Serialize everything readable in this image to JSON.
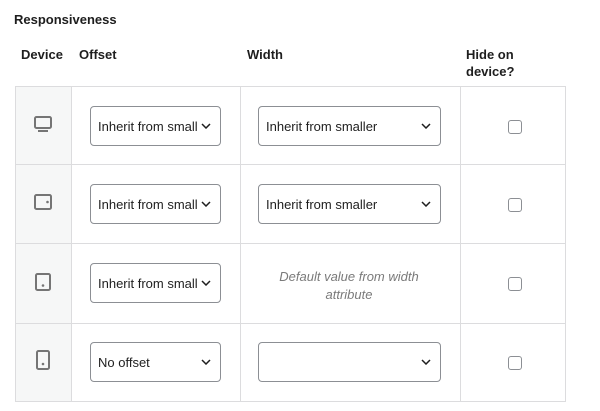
{
  "section_title": "Responsiveness",
  "headers": {
    "device": "Device",
    "offset": "Offset",
    "width": "Width",
    "hide": "Hide on device?"
  },
  "rows": [
    {
      "device_icon": "desktop-icon",
      "offset_value": "Inherit from smaller",
      "width_value": "Inherit from smaller",
      "width_note": "",
      "hide_checked": false
    },
    {
      "device_icon": "tablet-landscape-icon",
      "offset_value": "Inherit from smaller",
      "width_value": "Inherit from smaller",
      "width_note": "",
      "hide_checked": false
    },
    {
      "device_icon": "tablet-portrait-icon",
      "offset_value": "Inherit from smaller",
      "width_value": "",
      "width_note": "Default value from width attribute",
      "hide_checked": false
    },
    {
      "device_icon": "mobile-icon",
      "offset_value": "No offset",
      "width_value": "",
      "width_note": "",
      "hide_checked": false
    }
  ],
  "colors": {
    "border": "#dcdcde",
    "device_column_bg": "#f6f7f7",
    "icon": "#757575",
    "control_border": "#8c8f94",
    "note_text": "#7a7a7a"
  }
}
